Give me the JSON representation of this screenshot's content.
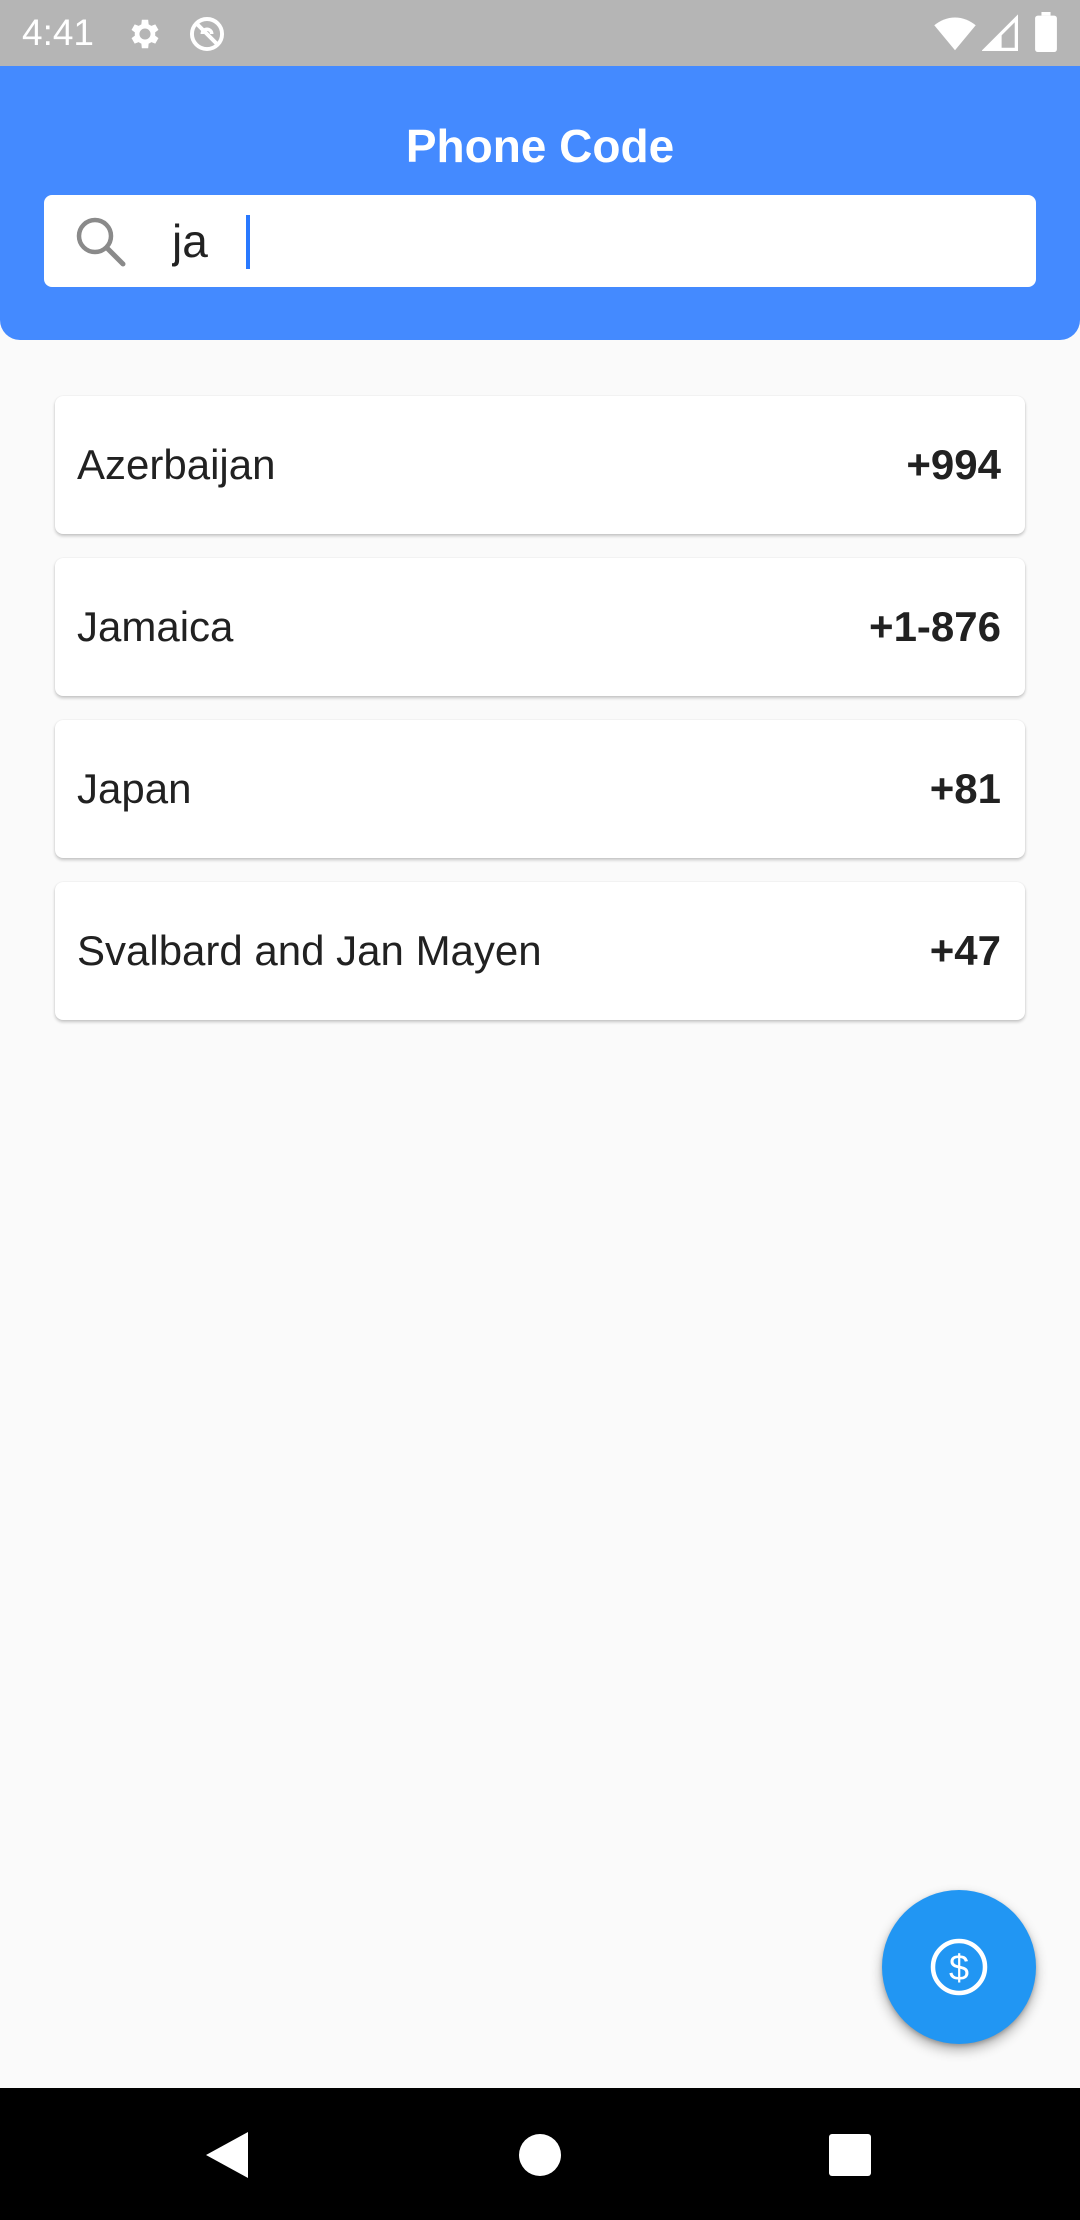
{
  "status_bar": {
    "time": "4:41",
    "icons": [
      "gear-icon",
      "do-not-disturb-icon",
      "wifi-icon",
      "cellular-signal-icon",
      "battery-icon"
    ]
  },
  "app_bar": {
    "title": "Phone Code",
    "background_color": "#448aff"
  },
  "search": {
    "value": "ja",
    "icon": "search-icon"
  },
  "results": [
    {
      "country": "Azerbaijan",
      "code": "+994"
    },
    {
      "country": "Jamaica",
      "code": "+1-876"
    },
    {
      "country": "Japan",
      "code": "+81"
    },
    {
      "country": "Svalbard and Jan Mayen",
      "code": "+47"
    }
  ],
  "fab": {
    "icon": "dollar-circle-icon",
    "color": "#2196f3"
  },
  "nav_bar": {
    "buttons": [
      "back-icon",
      "home-icon",
      "recents-icon"
    ]
  }
}
